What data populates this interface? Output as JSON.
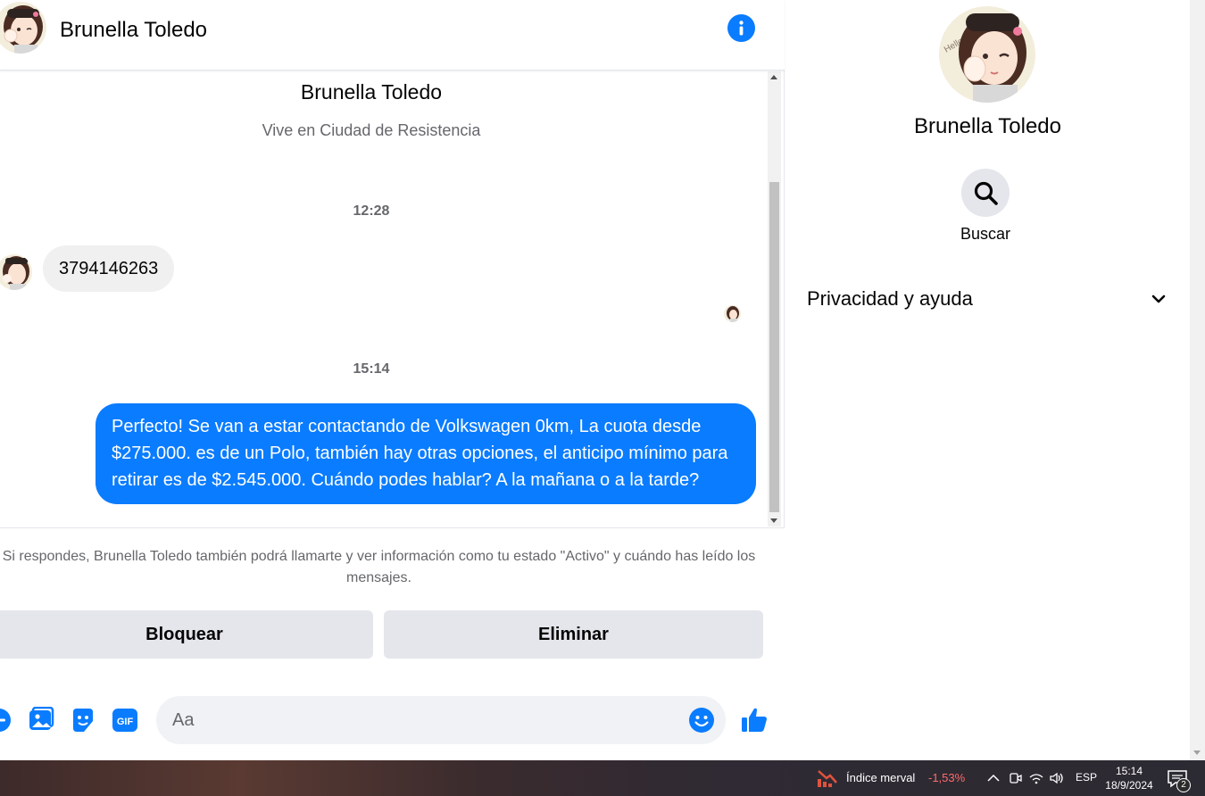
{
  "header": {
    "contact_name": "Brunella Toledo"
  },
  "conversation": {
    "profile_name": "Brunella Toledo",
    "profile_subtitle": "Vive en Ciudad de Resistencia",
    "timestamps": [
      "12:28",
      "15:14"
    ],
    "incoming_message": "3794146263",
    "outgoing_message": "Perfecto!  Se van a estar contactando de Volkswagen 0km, La cuota desde $275.000. es de un Polo, también hay otras opciones, el anticipo mínimo para retirar es de $2.545.000. Cuándo podes hablar? A la mañana o a la tarde?"
  },
  "notice": {
    "text": "Si respondes, Brunella Toledo también podrá llamarte y ver información como tu estado \"Activo\" y cuándo has leído los mensajes.",
    "block_label": "Bloquear",
    "delete_label": "Eliminar"
  },
  "composer": {
    "placeholder": "Aa"
  },
  "panel": {
    "name": "Brunella Toledo",
    "search_label": "Buscar",
    "privacy_label": "Privacidad y ayuda"
  },
  "taskbar": {
    "stock_name": "Índice merval",
    "stock_change": "-1,53%",
    "language": "ESP",
    "time": "15:14",
    "date": "18/9/2024",
    "notification_count": "2"
  },
  "colors": {
    "accent": "#0a7cff",
    "bubble_in": "#f0f0f0",
    "button_bg": "#e4e6eb",
    "stock_negative": "#ff6b6b"
  },
  "icons": [
    "info-icon",
    "plus-icon",
    "image-icon",
    "sticker-icon",
    "gif-icon",
    "emoji-icon",
    "like-icon",
    "search-icon",
    "chevron-down-icon"
  ]
}
